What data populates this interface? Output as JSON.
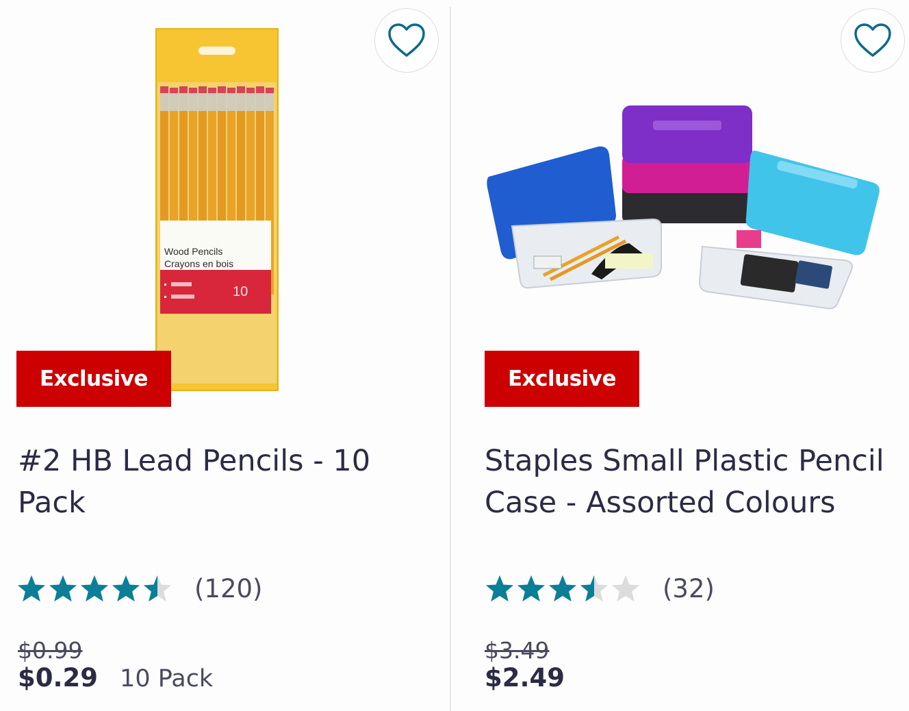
{
  "products": [
    {
      "badge": "Exclusive",
      "title": "#2 HB Lead Pencils - 10 Pack",
      "rating": 4.5,
      "review_count": "(120)",
      "was_price": "$0.99",
      "price": "$0.29",
      "unit": "10 Pack",
      "image_icon": "pencil-pack-image",
      "package_label_1": "Wood Pencils",
      "package_label_2": "Crayons en bois",
      "package_count": "10"
    },
    {
      "badge": "Exclusive",
      "title": "Staples Small Plastic Pencil Case - Assorted Colours",
      "rating": 3.5,
      "review_count": "(32)",
      "was_price": "$3.49",
      "price": "$2.49",
      "image_icon": "pencil-case-image"
    }
  ],
  "colors": {
    "star_filled": "#0a7f96",
    "star_empty": "#dcdcdc",
    "badge_bg": "#cc0000",
    "heart": "#0a6b8c",
    "text": "#2b2b45"
  }
}
